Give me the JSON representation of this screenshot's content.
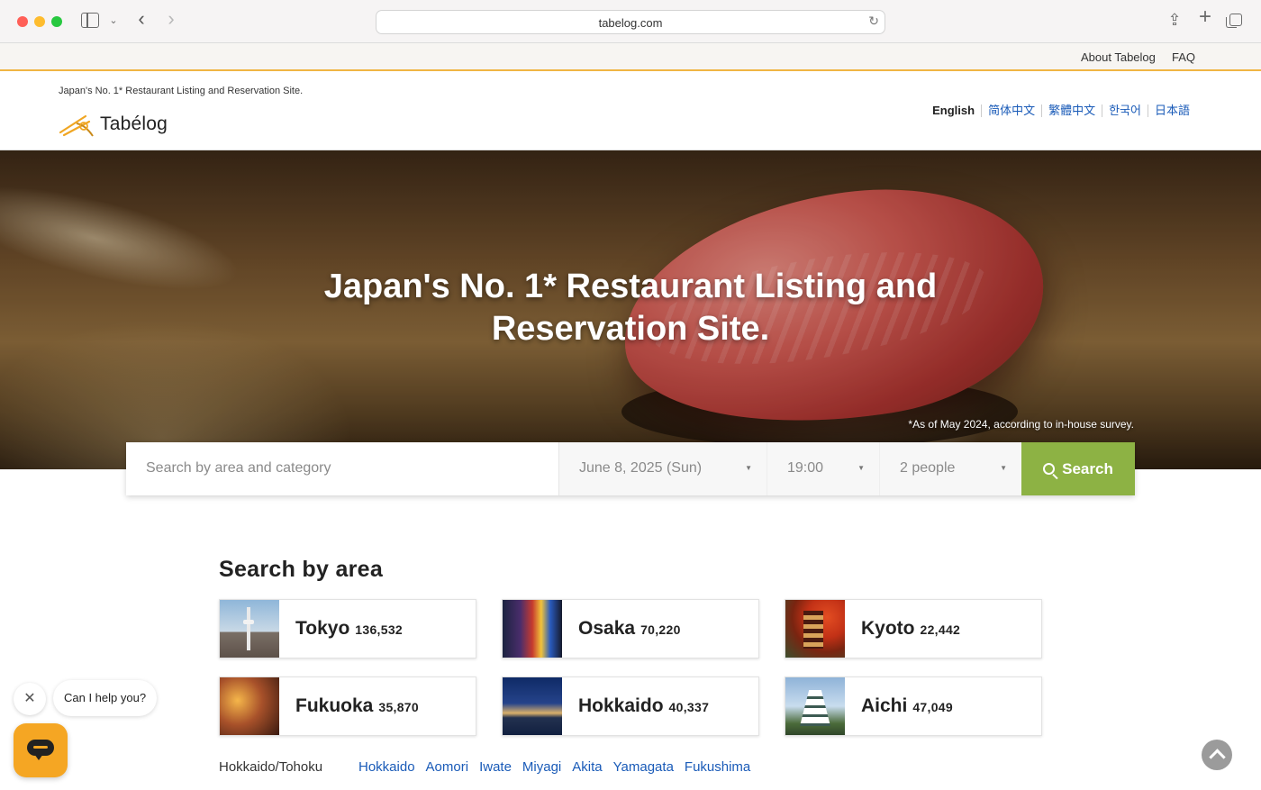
{
  "browser": {
    "url": "tabelog.com",
    "icons": [
      "sidebar-toggle-icon",
      "chevron-down-icon",
      "back-icon",
      "forward-icon",
      "reload-icon",
      "share-icon",
      "new-tab-icon",
      "tabs-overview-icon"
    ]
  },
  "top_links": {
    "about": "About Tabelog",
    "faq": "FAQ"
  },
  "header": {
    "tagline": "Japan's No. 1* Restaurant Listing and Reservation Site.",
    "logo_text": "Tabélog",
    "languages": [
      "English",
      "简体中文",
      "繁體中文",
      "한국어",
      "日本語"
    ],
    "active_language": "English"
  },
  "hero": {
    "title_line1": "Japan's No. 1* Restaurant Listing and",
    "title_line2": "Reservation Site.",
    "note": "*As of May 2024, according to in-house survey."
  },
  "search": {
    "area_placeholder": "Search by area and category",
    "date": "June 8, 2025 (Sun)",
    "time": "19:00",
    "people": "2 people",
    "button_label": "Search"
  },
  "areas": {
    "title": "Search by area",
    "cards": [
      {
        "name": "Tokyo",
        "count": "136,532"
      },
      {
        "name": "Osaka",
        "count": "70,220"
      },
      {
        "name": "Kyoto",
        "count": "22,442"
      },
      {
        "name": "Fukuoka",
        "count": "35,870"
      },
      {
        "name": "Hokkaido",
        "count": "40,337"
      },
      {
        "name": "Aichi",
        "count": "47,049"
      }
    ],
    "region": {
      "name": "Hokkaido/Tohoku",
      "prefectures": [
        "Hokkaido",
        "Aomori",
        "Iwate",
        "Miyagi",
        "Akita",
        "Yamagata",
        "Fukushima"
      ]
    }
  },
  "chat": {
    "bubble": "Can I help you?"
  },
  "colors": {
    "accent_orange": "#f0b544",
    "search_green": "#8db244",
    "link_blue": "#1a5bb8",
    "chat_orange": "#f5a623"
  }
}
